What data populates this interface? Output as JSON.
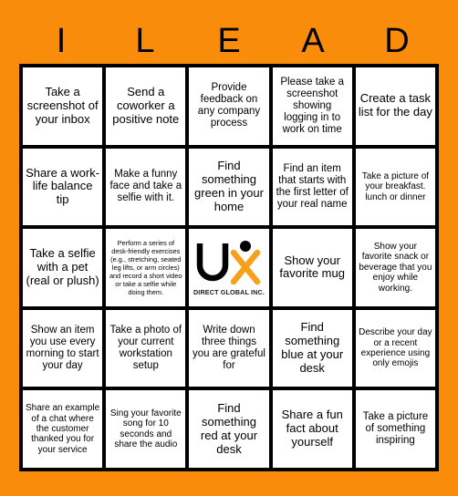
{
  "card": {
    "header_letters": [
      "I",
      "L",
      "E",
      "A",
      "D"
    ],
    "background_color": "#FA8C0B",
    "grid_line_color": "#000000",
    "cell_color": "#FFFFFF",
    "text_color": "#000000"
  },
  "logo": {
    "letter_u": "U",
    "letter_x": "X",
    "subtitle": "DIRECT GLOBAL INC.",
    "u_color": "#000000",
    "x_color": "#F5A11B",
    "dot_color": "#000000"
  },
  "cells": [
    {
      "row": 1,
      "col": 1,
      "text": "Take a screenshot of your inbox",
      "size": "lg"
    },
    {
      "row": 1,
      "col": 2,
      "text": "Send a coworker a positive note",
      "size": "lg"
    },
    {
      "row": 1,
      "col": 3,
      "text": "Provide feedback on any company process",
      "size": "md"
    },
    {
      "row": 1,
      "col": 4,
      "text": "Please take a screenshot showing logging in to work on time",
      "size": "md"
    },
    {
      "row": 1,
      "col": 5,
      "text": "Create a task list for the day",
      "size": "lg"
    },
    {
      "row": 2,
      "col": 1,
      "text": "Share a work-life balance tip",
      "size": "lg"
    },
    {
      "row": 2,
      "col": 2,
      "text": "Make a funny face and take a selfie with it.",
      "size": "md"
    },
    {
      "row": 2,
      "col": 3,
      "text": "Find something green in your home",
      "size": "lg"
    },
    {
      "row": 2,
      "col": 4,
      "text": "Find an item that starts with the first letter of your real name",
      "size": "md"
    },
    {
      "row": 2,
      "col": 5,
      "text": "Take a picture of your breakfast. lunch or dinner",
      "size": "sm"
    },
    {
      "row": 3,
      "col": 1,
      "text": "Take a selfie with a pet (real or plush)",
      "size": "lg"
    },
    {
      "row": 3,
      "col": 2,
      "text": "Perform a series of desk-friendly exercises (e.g., stretching, seated leg lifts, or arm circles) and record a short video or take a selfie while doing them.",
      "size": "xs"
    },
    {
      "row": 3,
      "col": 3,
      "text": "",
      "size": "logo"
    },
    {
      "row": 3,
      "col": 4,
      "text": "Show your favorite mug",
      "size": "lg"
    },
    {
      "row": 3,
      "col": 5,
      "text": "Show your favorite snack or beverage that you enjoy while working.",
      "size": "sm"
    },
    {
      "row": 4,
      "col": 1,
      "text": "Show an item you use every morning to start your day",
      "size": "md"
    },
    {
      "row": 4,
      "col": 2,
      "text": "Take a photo of your current workstation setup",
      "size": "md"
    },
    {
      "row": 4,
      "col": 3,
      "text": "Write down three things you are grateful for",
      "size": "md"
    },
    {
      "row": 4,
      "col": 4,
      "text": "Find something blue at your desk",
      "size": "lg"
    },
    {
      "row": 4,
      "col": 5,
      "text": "Describe your day or a recent experience using only emojis",
      "size": "sm"
    },
    {
      "row": 5,
      "col": 1,
      "text": "Share an example of a chat where the customer thanked you for your service",
      "size": "sm"
    },
    {
      "row": 5,
      "col": 2,
      "text": "Sing your favorite song for 10 seconds and share the audio",
      "size": "sm"
    },
    {
      "row": 5,
      "col": 3,
      "text": "Find something red at your desk",
      "size": "lg"
    },
    {
      "row": 5,
      "col": 4,
      "text": "Share a fun fact about yourself",
      "size": "lg"
    },
    {
      "row": 5,
      "col": 5,
      "text": "Take a picture of something inspiring",
      "size": "md"
    }
  ]
}
